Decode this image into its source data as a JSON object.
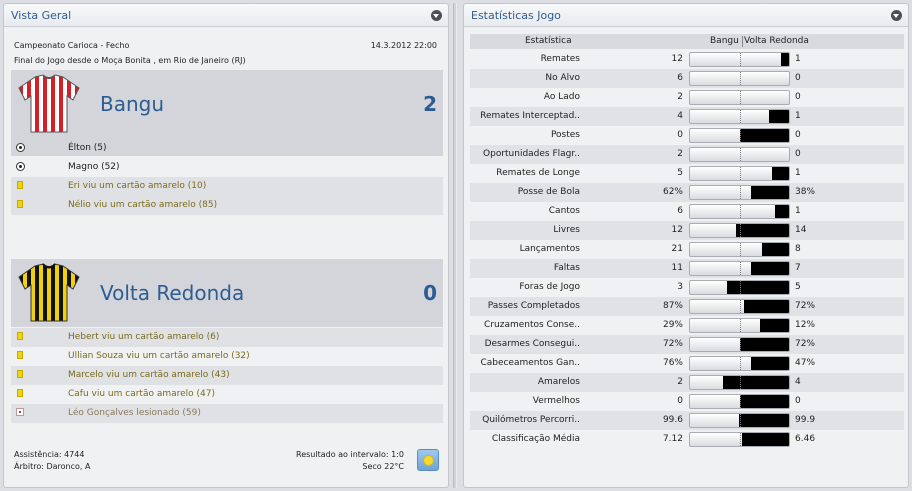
{
  "overview": {
    "title": "Vista Geral",
    "competition": "Campeonato Carioca - Fecho",
    "datetime": "14.3.2012 22:00",
    "venue": "Final do Jogo desde o Moça Bonita , em Rio de Janeiro (RJ)",
    "home": {
      "name": "Bangu",
      "score": "2",
      "kit": {
        "primary": "#d42027",
        "secondary": "#ffffff"
      },
      "events": [
        {
          "icon": "ball-icon",
          "text": "Élton (5)",
          "kind": "goal"
        },
        {
          "icon": "ball-icon",
          "text": "Magno (52)",
          "kind": "goal"
        },
        {
          "icon": "yellow-card-icon",
          "text": "Eri viu um cartão amarelo (10)",
          "kind": "card"
        },
        {
          "icon": "yellow-card-icon",
          "text": "Nélio viu um cartão amarelo (85)",
          "kind": "card"
        }
      ]
    },
    "away": {
      "name": "Volta Redonda",
      "score": "0",
      "kit": {
        "primary": "#f1d10e",
        "secondary": "#111111"
      },
      "events": [
        {
          "icon": "yellow-card-icon",
          "text": "Hebert viu um cartão amarelo (6)",
          "kind": "card"
        },
        {
          "icon": "yellow-card-icon",
          "text": "Ullian Souza viu um cartão amarelo (32)",
          "kind": "card"
        },
        {
          "icon": "yellow-card-icon",
          "text": "Marcelo viu um cartão amarelo (43)",
          "kind": "card"
        },
        {
          "icon": "yellow-card-icon",
          "text": "Cafu viu um cartão amarelo (47)",
          "kind": "card"
        },
        {
          "icon": "injury-icon",
          "text": "Léo Gonçalves lesionado (59)",
          "kind": "injury"
        }
      ]
    },
    "attendance": "Assistência: 4744",
    "referee": "Árbitro: Daronco, A",
    "halftime": "Resultado ao intervalo: 1:0",
    "weather": "Seco 22°C"
  },
  "stats": {
    "title": "Estatísticas Jogo",
    "header": {
      "stat": "Estatística",
      "home": "Bangu",
      "away": "Volta Redonda"
    },
    "rows": [
      {
        "label": "Remates",
        "home": "12",
        "away": "1",
        "away_share": 0.077
      },
      {
        "label": "No Alvo",
        "home": "6",
        "away": "0",
        "away_share": 0
      },
      {
        "label": "Ao Lado",
        "home": "2",
        "away": "0",
        "away_share": 0
      },
      {
        "label": "Remates Interceptad..",
        "home": "4",
        "away": "1",
        "away_share": 0.2
      },
      {
        "label": "Postes",
        "home": "0",
        "away": "0",
        "away_share": 0.5
      },
      {
        "label": "Oportunidades Flagr..",
        "home": "2",
        "away": "0",
        "away_share": 0
      },
      {
        "label": "Remates de Longe",
        "home": "5",
        "away": "1",
        "away_share": 0.167
      },
      {
        "label": "Posse de Bola",
        "home": "62%",
        "away": "38%",
        "away_share": 0.38
      },
      {
        "label": "Cantos",
        "home": "6",
        "away": "1",
        "away_share": 0.143
      },
      {
        "label": "Livres",
        "home": "12",
        "away": "14",
        "away_share": 0.538
      },
      {
        "label": "Lançamentos",
        "home": "21",
        "away": "8",
        "away_share": 0.276
      },
      {
        "label": "Faltas",
        "home": "11",
        "away": "7",
        "away_share": 0.389
      },
      {
        "label": "Foras de Jogo",
        "home": "3",
        "away": "5",
        "away_share": 0.625
      },
      {
        "label": "Passes Completados",
        "home": "87%",
        "away": "72%",
        "away_share": 0.453
      },
      {
        "label": "Cruzamentos Conse..",
        "home": "29%",
        "away": "12%",
        "away_share": 0.293
      },
      {
        "label": "Desarmes Consegui..",
        "home": "72%",
        "away": "72%",
        "away_share": 0.5
      },
      {
        "label": "Cabeceamentos Gan..",
        "home": "76%",
        "away": "47%",
        "away_share": 0.382
      },
      {
        "label": "Amarelos",
        "home": "2",
        "away": "4",
        "away_share": 0.667
      },
      {
        "label": "Vermelhos",
        "home": "0",
        "away": "0",
        "away_share": 0.5
      },
      {
        "label": "Quilómetros Percorri..",
        "home": "99.6",
        "away": "99.9",
        "away_share": 0.501
      },
      {
        "label": "Classificação Média",
        "home": "7.12",
        "away": "6.46",
        "away_share": 0.476
      }
    ]
  }
}
